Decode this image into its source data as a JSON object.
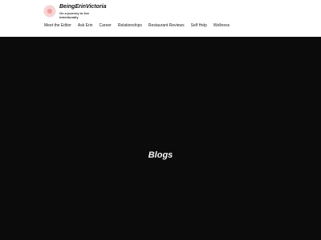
{
  "header": {
    "logo_icon": "circle-logo-icon",
    "site_title": "BeingErinVictoria",
    "tagline": "On a journey to live intentionally"
  },
  "nav": {
    "items": [
      {
        "label": "Meet the Editor"
      },
      {
        "label": "Ask Erin"
      },
      {
        "label": "Career"
      },
      {
        "label": "Relationships"
      },
      {
        "label": "Restaurant Reviews"
      },
      {
        "label": "Self Help"
      },
      {
        "label": "Wellness"
      }
    ]
  },
  "hero": {
    "title": "Blogs"
  },
  "colors": {
    "hero_background": "#0b0b0b",
    "logo_accent": "#ef9f9f"
  }
}
